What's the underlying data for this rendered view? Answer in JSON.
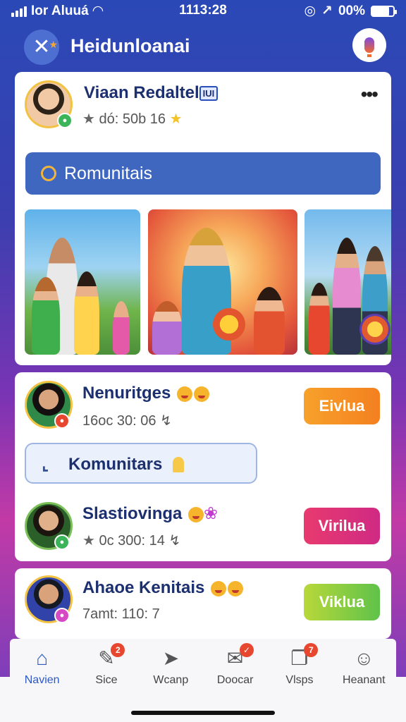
{
  "status_bar": {
    "carrier": "Ior Aluuá",
    "time": "1113:28",
    "battery_text": "00%",
    "battery_level": 0.8
  },
  "header": {
    "title": "Heidunloanai",
    "close_icon": "close-icon",
    "mic_icon": "mic-icon"
  },
  "profile": {
    "name": "Viaan Redaltel",
    "tag": "IUI",
    "meta": "dó: 50b 16"
  },
  "community_bar": {
    "label": "Romunitais"
  },
  "posts": [
    {
      "name": "Nenuritges",
      "meta": "16oc 30: 06 ↯",
      "button": "Eivlua"
    },
    {
      "name": "Slastiovinga",
      "meta": "0c 300: 14 ↯",
      "button": "Virilua"
    },
    {
      "name": "Ahaoe Kenitais",
      "meta": "7amt: 110: 7",
      "button": "Viklua"
    }
  ],
  "komunitas_chip": {
    "label": "Komunitars"
  },
  "nav": {
    "items": [
      {
        "label": "Navien",
        "icon": "home-icon",
        "badge": ""
      },
      {
        "label": "Sice",
        "icon": "edit-icon",
        "badge": "2"
      },
      {
        "label": "Wcanp",
        "icon": "navigate-icon",
        "badge": ""
      },
      {
        "label": "Doocar",
        "icon": "mail-icon",
        "badge": "✓"
      },
      {
        "label": "Vlsps",
        "icon": "chat-icon",
        "badge": "7"
      },
      {
        "label": "Heanant",
        "icon": "user-icon",
        "badge": ""
      }
    ]
  },
  "colors": {
    "accent": "#2d58c6",
    "brand_blue": "#3f67bf",
    "orange": "#f48020",
    "pink": "#e83a6f",
    "green": "#5fc24a"
  }
}
